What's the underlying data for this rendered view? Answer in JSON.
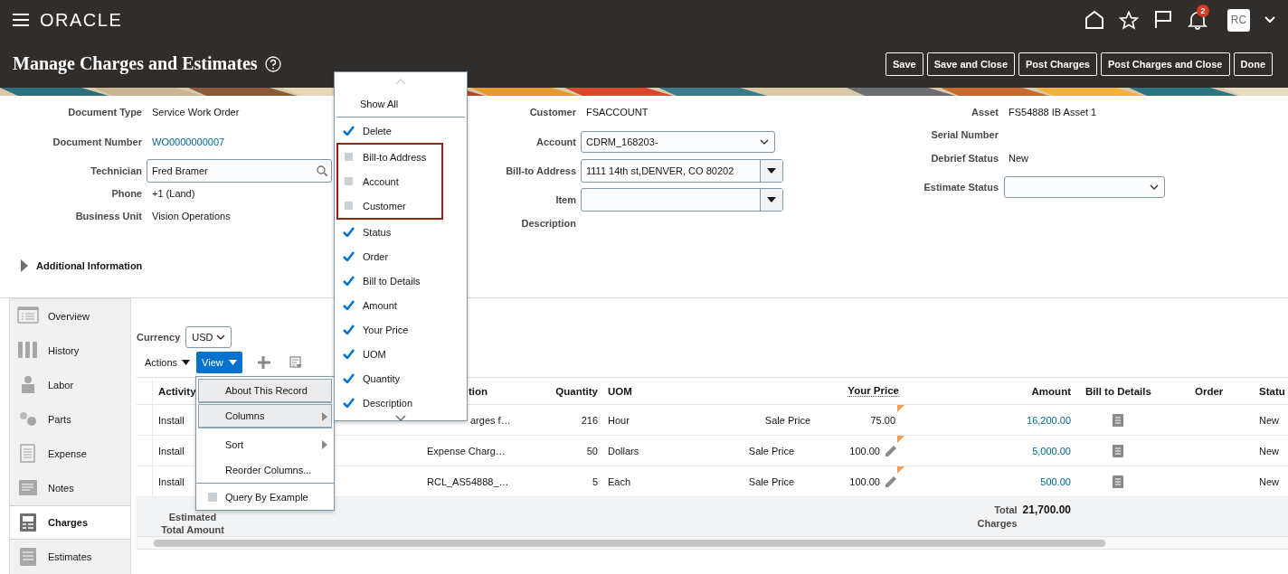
{
  "header": {
    "brand": "ORACLE",
    "notification_count": "2",
    "user_initials": "RC"
  },
  "page": {
    "title": "Manage Charges and Estimates",
    "buttons": [
      "Save",
      "Save and Close",
      "Post Charges",
      "Post Charges and Close",
      "Done"
    ]
  },
  "form": {
    "columns": [
      [
        {
          "label": "Document Type",
          "kind": "text",
          "value": "Service Work Order"
        },
        {
          "label": "Document Number",
          "kind": "link",
          "value": "WO0000000007"
        },
        {
          "label": "Technician",
          "kind": "search",
          "value": "Fred Bramer"
        },
        {
          "label": "Phone",
          "kind": "text",
          "value": "+1 (Land)"
        },
        {
          "label": "Business Unit",
          "kind": "text",
          "value": "Vision Operations"
        }
      ],
      [
        {
          "label": "Customer",
          "kind": "text",
          "value": "FSACCOUNT"
        },
        {
          "label": "Account",
          "kind": "select",
          "value": "CDRM_168203-"
        },
        {
          "label": "Bill-to Address",
          "kind": "combo",
          "value": "1111 14th st,DENVER, CO 80202"
        },
        {
          "label": "Item",
          "kind": "combo"
        },
        {
          "label": "Description",
          "kind": "text"
        }
      ],
      [
        {
          "label": "Asset",
          "kind": "text",
          "value": "FS54888 IB Asset 1"
        },
        {
          "label": "Serial Number",
          "kind": "text"
        },
        {
          "label": "Debrief Status",
          "kind": "text",
          "value": "New"
        },
        {
          "label": "Estimate Status",
          "kind": "select"
        }
      ]
    ]
  },
  "additional_info": {
    "label": "Additional Information",
    "expanded": false
  },
  "sidebar": {
    "items": [
      {
        "label": "Overview",
        "selected": false
      },
      {
        "label": "History",
        "selected": false
      },
      {
        "label": "Labor",
        "selected": false
      },
      {
        "label": "Parts",
        "selected": false
      },
      {
        "label": "Expense",
        "selected": false
      },
      {
        "label": "Notes",
        "selected": false
      },
      {
        "label": "Charges",
        "selected": true
      },
      {
        "label": "Estimates",
        "selected": false
      }
    ]
  },
  "currency": {
    "label": "Currency",
    "value": "USD"
  },
  "toolbar": {
    "actions": "Actions",
    "view": "View"
  },
  "table": {
    "columns": [
      {
        "label": "Activity",
        "cut": false
      },
      {
        "label": "tion",
        "cut": true
      },
      {
        "label": "Quantity",
        "cut": false
      },
      {
        "label": "UOM",
        "cut": false
      },
      {
        "label": "Your Price",
        "cut": false
      },
      {
        "label": "Amount",
        "cut": false
      },
      {
        "label": "Bill to Details",
        "cut": false
      },
      {
        "label": "Order",
        "cut": false
      },
      {
        "label": "Statu",
        "cut": false
      }
    ],
    "rows": [
      {
        "activity": "Install",
        "description": {
          "text": "arges f…",
          "cut": true
        },
        "quantity": "216",
        "uom": "Hour",
        "price_type": "Sale Price",
        "your_price": "75.00",
        "editable": false,
        "amount": "16,200.00",
        "status": "New"
      },
      {
        "activity": "Install",
        "description": {
          "text": "Expense Charg…",
          "cut": false
        },
        "quantity": "50",
        "uom": "Dollars",
        "price_type": "Sale Price",
        "your_price": "100.00",
        "editable": true,
        "amount": "5,000.00",
        "status": "New"
      },
      {
        "activity": "Install",
        "description": {
          "text": "RCL_AS54888_…",
          "cut": false
        },
        "quantity": "5",
        "uom": "Each",
        "price_type": "Sale Price",
        "your_price": "100.00",
        "editable": true,
        "amount": "500.00",
        "status": "New"
      }
    ],
    "totals": {
      "estimated_label": "Estimated Total Amount",
      "charges_label": "Total Charges",
      "charges_value": "21,700.00"
    }
  },
  "view_menu": {
    "items": [
      {
        "label": "About This Record",
        "kind": "item",
        "highlighted": true
      },
      {
        "label": "Columns",
        "kind": "submenu",
        "highlighted": true
      },
      {
        "label": "Sort",
        "kind": "submenu",
        "highlighted": false
      },
      {
        "label": "Reorder Columns...",
        "kind": "item",
        "highlighted": false
      },
      {
        "label": "Query By Example",
        "kind": "check",
        "checked": false,
        "highlighted": false
      }
    ]
  },
  "columns_menu": {
    "show_all": "Show All",
    "items": [
      {
        "label": "Delete",
        "checked": true,
        "framed": false
      },
      {
        "label": "Bill-to Address",
        "checked": false,
        "framed": true
      },
      {
        "label": "Account",
        "checked": false,
        "framed": true
      },
      {
        "label": "Customer",
        "checked": false,
        "framed": true
      },
      {
        "label": "Status",
        "checked": true,
        "framed": false
      },
      {
        "label": "Order",
        "checked": true,
        "framed": false
      },
      {
        "label": "Bill to Details",
        "checked": true,
        "framed": false
      },
      {
        "label": "Amount",
        "checked": true,
        "framed": false
      },
      {
        "label": "Your Price",
        "checked": true,
        "framed": false
      },
      {
        "label": "UOM",
        "checked": true,
        "framed": false
      },
      {
        "label": "Quantity",
        "checked": true,
        "framed": false
      },
      {
        "label": "Description",
        "checked": true,
        "framed": false
      }
    ]
  }
}
